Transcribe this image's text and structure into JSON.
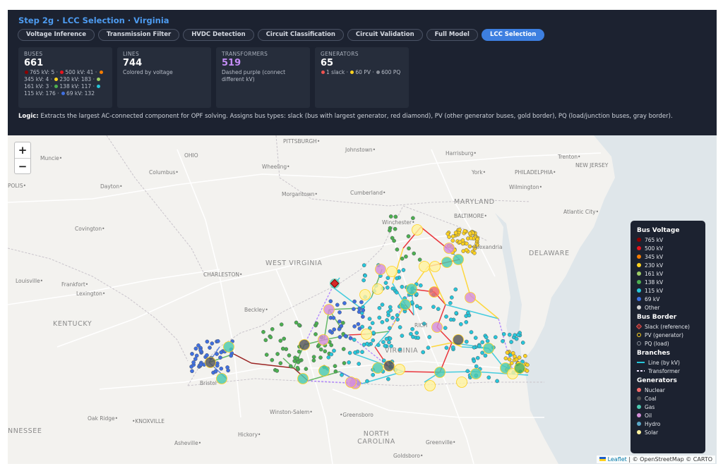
{
  "header": {
    "title": "Step 2g · LCC Selection · Virginia",
    "tabs": [
      {
        "label": "Voltage Inference",
        "active": false
      },
      {
        "label": "Transmission Filter",
        "active": false
      },
      {
        "label": "HVDC Detection",
        "active": false
      },
      {
        "label": "Circuit Classification",
        "active": false
      },
      {
        "label": "Circuit Validation",
        "active": false
      },
      {
        "label": "Full Model",
        "active": false
      },
      {
        "label": "LCC Selection",
        "active": true
      }
    ]
  },
  "cards": {
    "buses": {
      "label": "BUSES",
      "value": "661",
      "items": [
        {
          "text": "765 kV: 5",
          "color": "#8b0000"
        },
        {
          "text": "500 kV: 41",
          "color": "#e8141c"
        },
        {
          "text": "345 kV: 4",
          "color": "#f57c00"
        },
        {
          "text": "230 kV: 183",
          "color": "#ffd21f"
        },
        {
          "text": "161 kV: 3",
          "color": "#9ccc65"
        },
        {
          "text": "138 kV: 117",
          "color": "#4caf50"
        },
        {
          "text": "115 kV: 176",
          "color": "#26c6da"
        },
        {
          "text": "69 kV: 132",
          "color": "#3f6fe0"
        }
      ]
    },
    "lines": {
      "label": "LINES",
      "value": "744",
      "sub": "Colored by voltage"
    },
    "transformers": {
      "label": "TRANSFORMERS",
      "value": "519",
      "sub": "Dashed purple (connect different kV)"
    },
    "generators": {
      "label": "GENERATORS",
      "value": "65",
      "items": [
        {
          "text": "1 slack",
          "color": "#ef5350"
        },
        {
          "text": "60 PV",
          "color": "#ffd21f"
        },
        {
          "text": "600 PQ",
          "color": "#8a8f98"
        }
      ]
    }
  },
  "logic": {
    "label": "Logic:",
    "text": "Extracts the largest AC-connected component for OPF solving. Assigns bus types: slack (bus with largest generator, red diamond), PV (other generator buses, gold border), PQ (load/junction buses, gray border)."
  },
  "map": {
    "zoom_in": "+",
    "zoom_out": "−",
    "places": [
      {
        "id": "pittsburgh",
        "text": "PITTSBURGH•"
      },
      {
        "id": "johnstown",
        "text": "Johnstown•"
      },
      {
        "id": "harrisburg",
        "text": "Harrisburg•"
      },
      {
        "id": "trenton",
        "text": "Trenton•"
      },
      {
        "id": "new-jersey",
        "text": "NEW JERSEY"
      },
      {
        "id": "ohio",
        "text": "OHIO"
      },
      {
        "id": "muncie",
        "text": "Muncie•"
      },
      {
        "id": "columbus",
        "text": "Columbus•"
      },
      {
        "id": "wheeling",
        "text": "Wheeling•"
      },
      {
        "id": "york",
        "text": "York•"
      },
      {
        "id": "philadelphia",
        "text": "PHILADELPHIA•"
      },
      {
        "id": "polis",
        "text": "POLIS•"
      },
      {
        "id": "dayton",
        "text": "Dayton•"
      },
      {
        "id": "morgantown",
        "text": "Morgantown•"
      },
      {
        "id": "cumberland",
        "text": "Cumberland•"
      },
      {
        "id": "wilmington",
        "text": "Wilmington•"
      },
      {
        "id": "maryland",
        "text": "MARYLAND"
      },
      {
        "id": "baltimore",
        "text": "BALTIMORE•"
      },
      {
        "id": "atlantic-city",
        "text": "Atlantic City•"
      },
      {
        "id": "covington",
        "text": "Covington•"
      },
      {
        "id": "winchester",
        "text": "Winchester•"
      },
      {
        "id": "alexandria",
        "text": "•Alexandria"
      },
      {
        "id": "west-virginia",
        "text": "WEST VIRGINIA"
      },
      {
        "id": "delaware",
        "text": "DELAWARE"
      },
      {
        "id": "charleston",
        "text": "CHARLESTON•"
      },
      {
        "id": "louisville",
        "text": "Louisville•"
      },
      {
        "id": "frankfort",
        "text": "Frankfort•"
      },
      {
        "id": "lexington",
        "text": "Lexington•"
      },
      {
        "id": "beckley",
        "text": "Beckley•"
      },
      {
        "id": "kentucky",
        "text": "KENTUCKY"
      },
      {
        "id": "richmond",
        "text": "RICH"
      },
      {
        "id": "virginia",
        "text": "VIRGINIA"
      },
      {
        "id": "bristol",
        "text": "Bristol"
      },
      {
        "id": "winston-salem",
        "text": "Winston-Salem•"
      },
      {
        "id": "greensboro",
        "text": "•Greensboro"
      },
      {
        "id": "oak-ridge",
        "text": "Oak Ridge•"
      },
      {
        "id": "knoxville",
        "text": "•KNOXVILLE"
      },
      {
        "id": "nessee",
        "text": "NNESSEE"
      },
      {
        "id": "north-carolina",
        "text": "NORTH CAROLINA"
      },
      {
        "id": "hickory",
        "text": "Hickory•"
      },
      {
        "id": "asheville",
        "text": "Asheville•"
      },
      {
        "id": "greenville",
        "text": "Greenville•"
      },
      {
        "id": "goldsboro",
        "text": "Goldsboro•"
      }
    ]
  },
  "legend": {
    "bus_voltage_title": "Bus Voltage",
    "bus_voltage": [
      {
        "label": "765 kV",
        "color": "#8b0000"
      },
      {
        "label": "500 kV",
        "color": "#e8141c"
      },
      {
        "label": "345 kV",
        "color": "#f57c00"
      },
      {
        "label": "230 kV",
        "color": "#ffd21f"
      },
      {
        "label": "161 kV",
        "color": "#9ccc65"
      },
      {
        "label": "138 kV",
        "color": "#4caf50"
      },
      {
        "label": "115 kV",
        "color": "#26c6da"
      },
      {
        "label": "69 kV",
        "color": "#3f6fe0"
      },
      {
        "label": "Other",
        "color": "#d0d0d0"
      }
    ],
    "bus_border_title": "Bus Border",
    "bus_border": [
      {
        "label": "Slack (reference)",
        "color": "#e05050"
      },
      {
        "label": "PV (generator)",
        "color": "#ffd21f"
      },
      {
        "label": "PQ (load)",
        "color": "#8a8f98"
      }
    ],
    "branches_title": "Branches",
    "branches": [
      {
        "label": "Line (by kV)",
        "color": "#26c6da"
      },
      {
        "label": "Transformer",
        "color": "#f0e6ff"
      }
    ],
    "generators_title": "Generators",
    "generators": [
      {
        "label": "Nuclear",
        "color": "#f06a6a"
      },
      {
        "label": "Coal",
        "color": "#555555"
      },
      {
        "label": "Gas",
        "color": "#4cc9b0"
      },
      {
        "label": "Oil",
        "color": "#d48ed8"
      },
      {
        "label": "Hydro",
        "color": "#5ba7c9"
      },
      {
        "label": "Solar",
        "color": "#fff3a0"
      }
    ]
  },
  "attribution": {
    "leaflet": "Leaflet",
    "rest": " | © OpenStreetMap © CARTO"
  }
}
